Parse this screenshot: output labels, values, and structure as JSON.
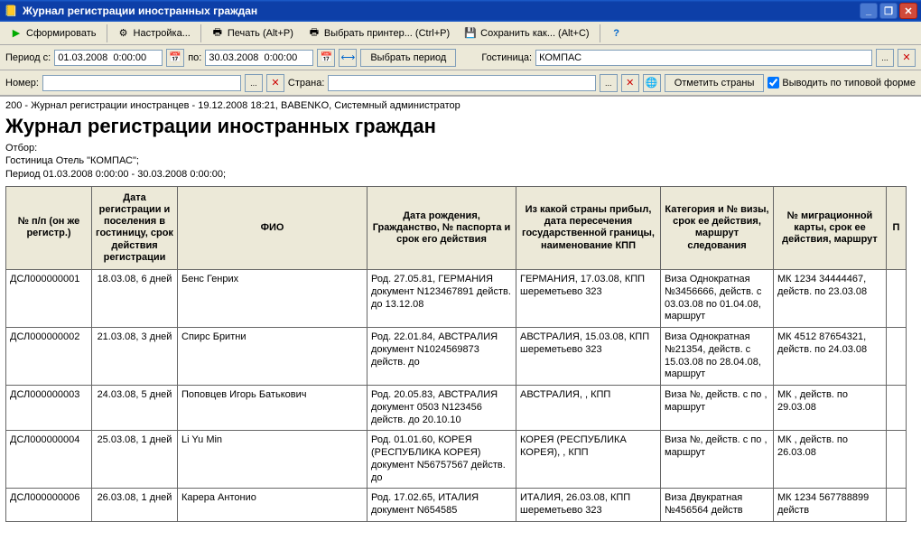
{
  "window": {
    "title": "Журнал регистрации иностранных граждан"
  },
  "toolbar": {
    "form_label": "Сформировать",
    "settings_label": "Настройка...",
    "print_label": "Печать  (Alt+P)",
    "select_printer_label": "Выбрать принтер... (Ctrl+P)",
    "save_as_label": "Сохранить как... (Alt+С)",
    "help_label": "?"
  },
  "filters": {
    "period_from_label": "Период с:",
    "period_from_value": "01.03.2008  0:00:00",
    "period_to_label": "по:",
    "period_to_value": "30.03.2008  0:00:00",
    "select_period_label": "Выбрать период",
    "hotel_label": "Гостиница:",
    "hotel_value": "КОМПАС",
    "number_label": "Номер:",
    "number_value": "",
    "country_label": "Страна:",
    "country_value": "",
    "mark_countries_label": "Отметить страны",
    "output_template_label": "Выводить по типовой форме"
  },
  "report": {
    "meta": "200 - Журнал регистрации иностранцев - 19.12.2008 18:21, BABENKO, Системный администратор",
    "title": "Журнал регистрации иностранных граждан",
    "otbor_label": "Отбор:",
    "hotel_line": "Гостиница Отель \"КОМПАС\";",
    "period_line": "Период 01.03.2008 0:00:00 - 30.03.2008 0:00:00;"
  },
  "columns": {
    "c0": "№ п/п\n(он же регистр.)",
    "c1": "Дата регистрации и поселения в гостиницу, срок действия регистрации",
    "c2": "ФИО",
    "c3": "Дата рождения, Гражданство,\n№ паспорта и срок его действия",
    "c4": "Из какой страны прибыл,\nдата пересечения государственной границы,\nнаименование КПП",
    "c5": "Категория и № визы, срок ее действия, маршрут следования",
    "c6": "№ миграционной карты, срок ее действия, маршрут",
    "c7": "П"
  },
  "rows": [
    {
      "a": "ДСЛ000000001",
      "b": "18.03.08, 6 дней",
      "c": "Бенс Генрих",
      "d": "Род. 27.05.81, ГЕРМАНИЯ документ N123467891 действ. до 13.12.08",
      "e": "ГЕРМАНИЯ, 17.03.08, КПП шереметьево 323",
      "f": "Виза Однократная №3456666, действ. с 03.03.08 по 01.04.08, маршрут",
      "g": "МК 1234 34444467, действ. по 23.03.08"
    },
    {
      "a": "ДСЛ000000002",
      "b": "21.03.08, 3 дней",
      "c": "Спирс Бритни",
      "d": "Род. 22.01.84, АВСТРАЛИЯ документ N1024569873 действ. до",
      "e": "АВСТРАЛИЯ, 15.03.08, КПП шереметьево 323",
      "f": "Виза Однократная №21354, действ. с 15.03.08 по 28.04.08, маршрут",
      "g": "МК 4512 87654321, действ. по 24.03.08"
    },
    {
      "a": "ДСЛ000000003",
      "b": "24.03.08, 5 дней",
      "c": "Поповцев Игорь Батькович",
      "d": "Род. 20.05.83, АВСТРАЛИЯ документ 0503 N123456 действ. до 20.10.10",
      "e": "АВСТРАЛИЯ, , КПП",
      "f": "Виза  №, действ. с  по , маршрут",
      "g": "МК , действ. по 29.03.08"
    },
    {
      "a": "ДСЛ000000004",
      "b": "25.03.08, 1 дней",
      "c": "Li Yu Min",
      "d": "Род. 01.01.60, КОРЕЯ (РЕСПУБЛИКА КОРЕЯ) документ N56757567 действ. до",
      "e": "КОРЕЯ (РЕСПУБЛИКА КОРЕЯ), , КПП",
      "f": "Виза  №, действ. с  по , маршрут",
      "g": "МК , действ. по 26.03.08"
    },
    {
      "a": "ДСЛ000000006",
      "b": "26.03.08, 1 дней",
      "c": "Карера Антонио",
      "d": "Род. 17.02.65, ИТАЛИЯ документ N654585",
      "e": "ИТАЛИЯ, 26.03.08, КПП шереметьево 323",
      "f": "Виза Двукратная №456564  действ",
      "g": "МК 1234 567788899  действ"
    }
  ]
}
